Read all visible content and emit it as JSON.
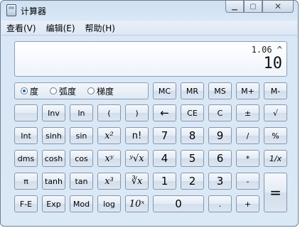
{
  "window": {
    "title": "计算器"
  },
  "menu": [
    "查看(V)",
    "编辑(E)",
    "帮助(H)"
  ],
  "display": {
    "expression": "1.06 ^",
    "value": "10"
  },
  "angle_modes": [
    {
      "label": "度",
      "selected": true
    },
    {
      "label": "弧度",
      "selected": false
    },
    {
      "label": "梯度",
      "selected": false
    }
  ],
  "memory": [
    "MC",
    "MR",
    "MS",
    "M+",
    "M-"
  ],
  "rows": {
    "r1": [
      "",
      "Inv",
      "ln",
      "(",
      ")",
      "←",
      "CE",
      "C",
      "±",
      "√"
    ],
    "r2": [
      "Int",
      "sinh",
      "sin",
      "x²",
      "n!",
      "7",
      "8",
      "9",
      "/",
      "%"
    ],
    "r3": [
      "dms",
      "cosh",
      "cos",
      "xʸ",
      "ʸ√x",
      "4",
      "5",
      "6",
      "*",
      "1/x"
    ],
    "r4": [
      "π",
      "tanh",
      "tan",
      "x³",
      "∛x",
      "1",
      "2",
      "3",
      "-",
      "="
    ],
    "r5": [
      "F-E",
      "Exp",
      "Mod",
      "log",
      "10ˣ",
      "0",
      ".",
      "+"
    ]
  }
}
